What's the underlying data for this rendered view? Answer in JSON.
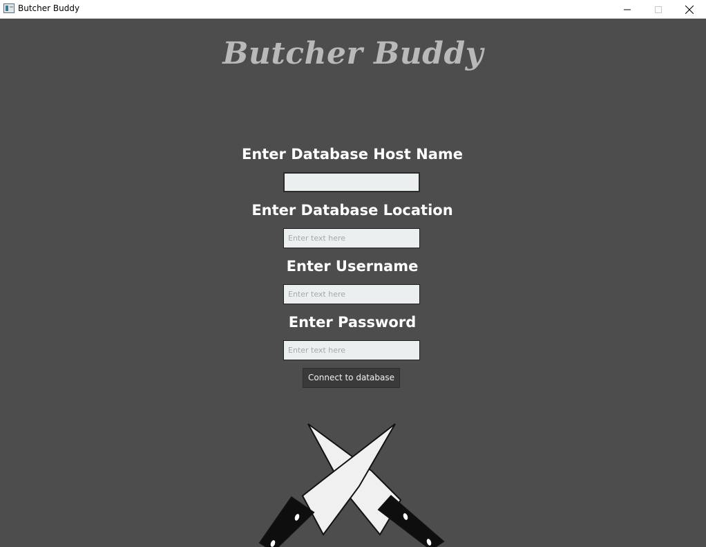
{
  "window": {
    "title": "Butcher Buddy",
    "icons": {
      "app": "app-icon",
      "minimize": "minimize-icon",
      "maximize": "maximize-icon",
      "close": "close-icon"
    }
  },
  "app": {
    "brand_title": "Butcher Buddy"
  },
  "form": {
    "host_label": "Enter Database Host Name",
    "host_value": "",
    "host_placeholder": "",
    "location_label": "Enter Database Location",
    "location_value": "",
    "location_placeholder": "Enter text here",
    "username_label": "Enter Username",
    "username_value": "",
    "username_placeholder": "Enter text here",
    "password_label": "Enter Password",
    "password_value": "",
    "password_placeholder": "Enter text here",
    "connect_label": "Connect to database"
  },
  "decoration": {
    "logo_icon": "crossed-knives-icon"
  },
  "colors": {
    "background": "#4d4d4d",
    "brand_text": "#b9b9b9",
    "label_text": "#ffffff",
    "input_bg": "#eceff0",
    "button_bg": "#3a3a3a"
  }
}
